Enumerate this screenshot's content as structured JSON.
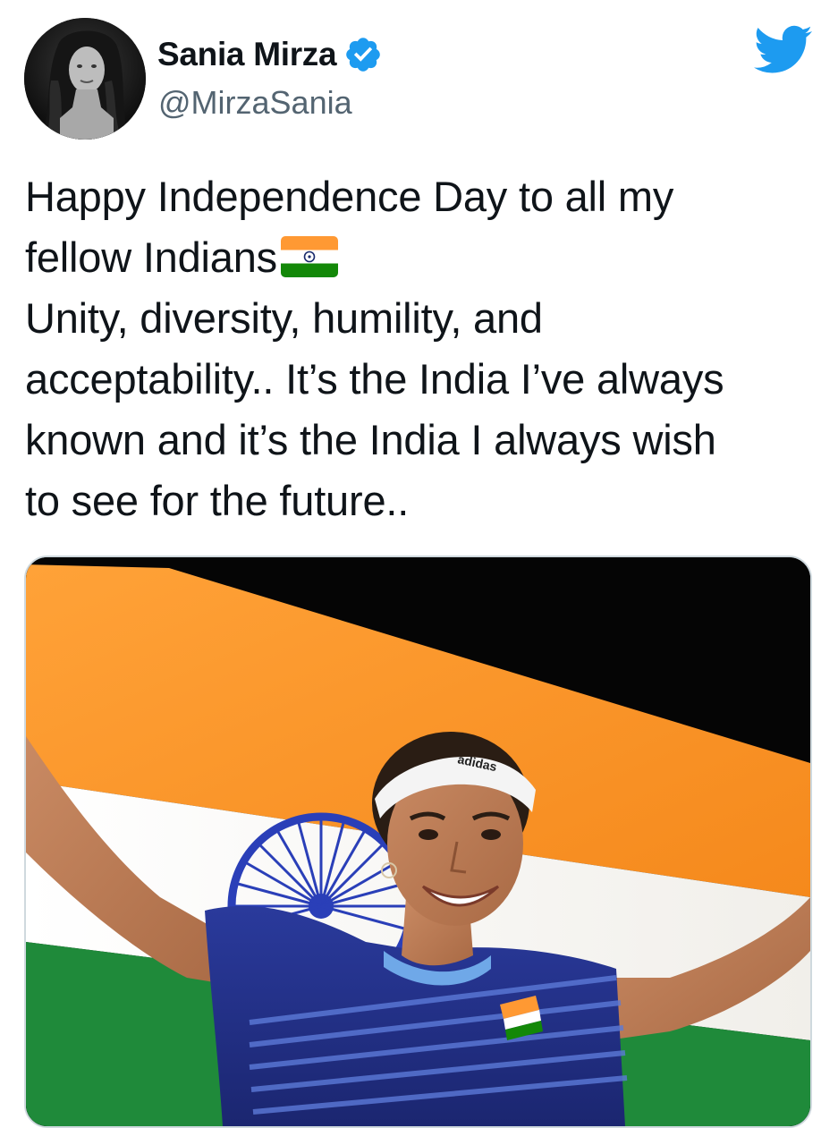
{
  "tweet": {
    "author": {
      "display_name": "Sania Mirza",
      "handle": "@MirzaSania",
      "verified": true,
      "avatar_icon": "profile-photo"
    },
    "text_lines": [
      "Happy Independence Day to all my",
      "fellow Indians",
      "Unity, diversity, humility, and",
      "acceptability.. It’s the India I’ve always",
      "known and it’s the India I always wish",
      "to see for the future.."
    ],
    "emoji": "india-flag-emoji",
    "media": {
      "type": "photo",
      "logo_text": "adidas"
    }
  },
  "brand": {
    "logo_icon": "twitter-bird-icon",
    "accent": "#1d9bf0"
  },
  "colors": {
    "text_primary": "#0f1419",
    "text_secondary": "#536471",
    "saffron": "#ff9a2e",
    "india_green": "#138808",
    "chakra_blue": "#2a3fb8",
    "card_border": "#cfd9de"
  }
}
